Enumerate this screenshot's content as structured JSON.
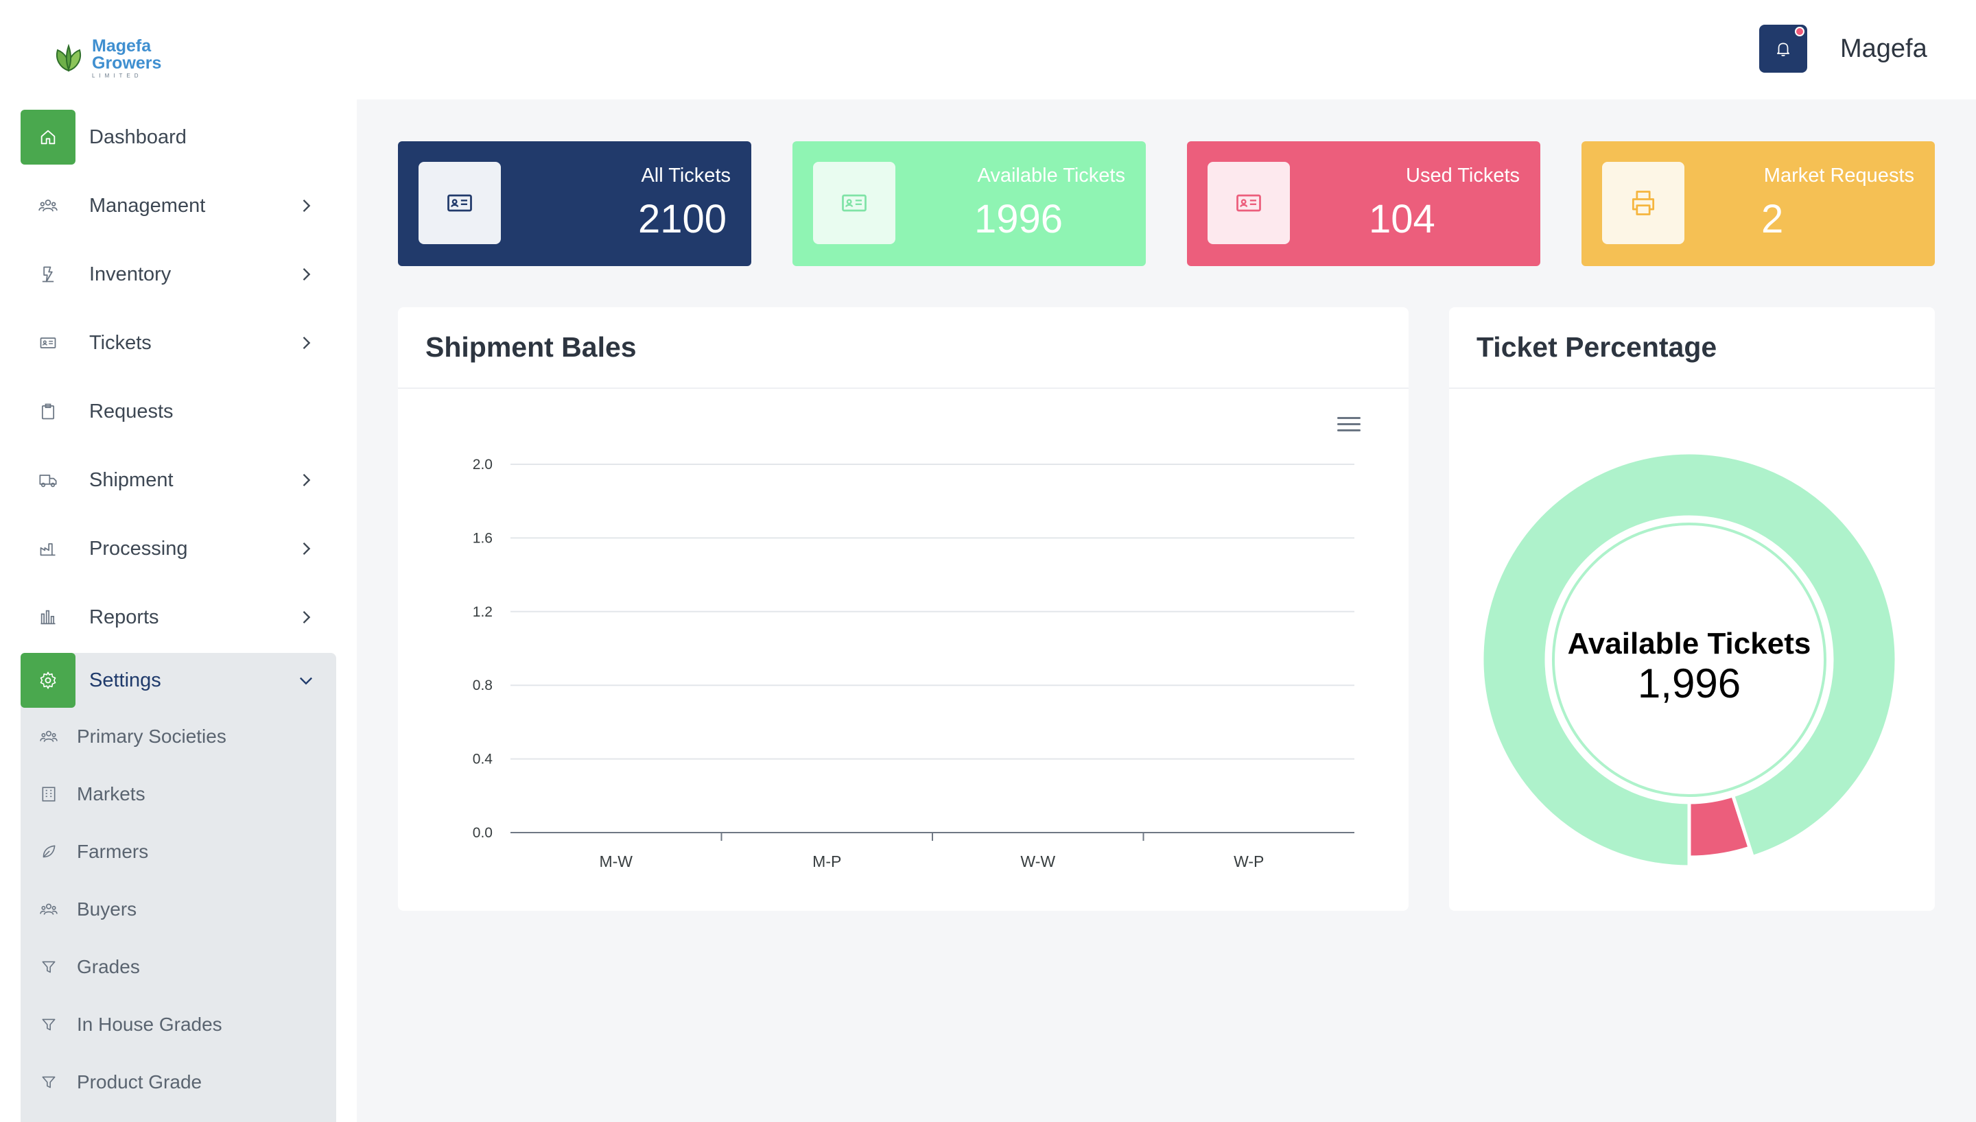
{
  "brand": {
    "logo_line1": "Magefa",
    "logo_line2": "Growers",
    "logo_line3": "LIMITED"
  },
  "sidebar": {
    "items": [
      {
        "label": "Dashboard",
        "icon": "home-icon",
        "active": true,
        "chevron": false
      },
      {
        "label": "Management",
        "icon": "users-icon",
        "chevron": true
      },
      {
        "label": "Inventory",
        "icon": "inventory-icon",
        "chevron": true
      },
      {
        "label": "Tickets",
        "icon": "ticket-icon",
        "chevron": true
      },
      {
        "label": "Requests",
        "icon": "clipboard-icon",
        "chevron": false
      },
      {
        "label": "Shipment",
        "icon": "truck-icon",
        "chevron": true
      },
      {
        "label": "Processing",
        "icon": "factory-icon",
        "chevron": true
      },
      {
        "label": "Reports",
        "icon": "bar-chart-icon",
        "chevron": true
      }
    ],
    "settings": {
      "label": "Settings",
      "icon": "gear-icon",
      "expanded": true,
      "children": [
        {
          "label": "Primary Societies",
          "icon": "users-icon"
        },
        {
          "label": "Markets",
          "icon": "building-icon"
        },
        {
          "label": "Farmers",
          "icon": "leaf-icon"
        },
        {
          "label": "Buyers",
          "icon": "users-icon"
        },
        {
          "label": "Grades",
          "icon": "filter-icon"
        },
        {
          "label": "In House Grades",
          "icon": "filter-icon"
        },
        {
          "label": "Product Grade",
          "icon": "filter-icon"
        }
      ]
    }
  },
  "header": {
    "username": "Magefa",
    "notification_icon": "bell-icon",
    "has_notification": true
  },
  "stats": [
    {
      "title": "All Tickets",
      "value": "2100",
      "icon": "id-card-icon",
      "color": "#213a6b"
    },
    {
      "title": "Available Tickets",
      "value": "1996",
      "icon": "id-card-icon",
      "color": "#8ff4b3"
    },
    {
      "title": "Used Tickets",
      "value": "104",
      "icon": "id-card-icon",
      "color": "#ec5e7c"
    },
    {
      "title": "Market Requests",
      "value": "2",
      "icon": "printer-icon",
      "color": "#f5c054"
    }
  ],
  "shipment_panel": {
    "title": "Shipment Bales",
    "menu_icon": "hamburger-menu-icon"
  },
  "ticket_panel": {
    "title": "Ticket Percentage",
    "center_label": "Available Tickets",
    "center_value": "1,996"
  },
  "chart_data": [
    {
      "type": "bar",
      "title": "",
      "categories": [
        "M-W",
        "M-P",
        "W-W",
        "W-P"
      ],
      "values": [
        0,
        0,
        0,
        0
      ],
      "y_ticks": [
        "0.0",
        "0.4",
        "0.8",
        "1.2",
        "1.6",
        "2.0"
      ],
      "ylim": [
        0,
        2.0
      ],
      "grid": true,
      "xlabel": "",
      "ylabel": ""
    },
    {
      "type": "pie",
      "subtype": "donut",
      "title": "",
      "slices": [
        {
          "label": "Available Tickets",
          "value": 1996,
          "color": "#aef2cb"
        },
        {
          "label": "Used Tickets",
          "value": 104,
          "color": "#ec5e7c"
        }
      ]
    }
  ]
}
